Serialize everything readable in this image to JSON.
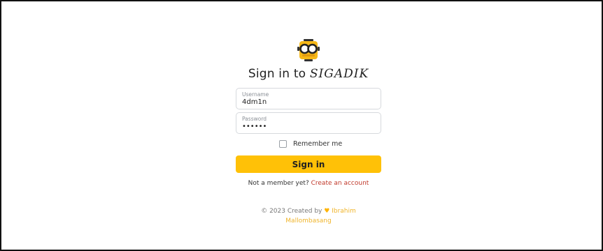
{
  "login": {
    "logo_icon": "robot-glasses-icon",
    "title_prefix": "Sign in to",
    "title_brand": "SIGADIK",
    "username": {
      "label": "Username",
      "value": "4dm1n"
    },
    "password": {
      "label": "Password",
      "value": "••••••"
    },
    "remember_label": "Remember me",
    "signin_label": "Sign in",
    "member_text": "Not a member yet?",
    "create_account_label": "Create an account"
  },
  "footer": {
    "prefix": "© 2023 Created by",
    "heart_icon": "heart-icon",
    "author_first": "Ibrahim",
    "author_last": "Mallombasang"
  },
  "colors": {
    "accent": "#ffc107",
    "link": "#c0392b",
    "author": "#f0b429"
  }
}
